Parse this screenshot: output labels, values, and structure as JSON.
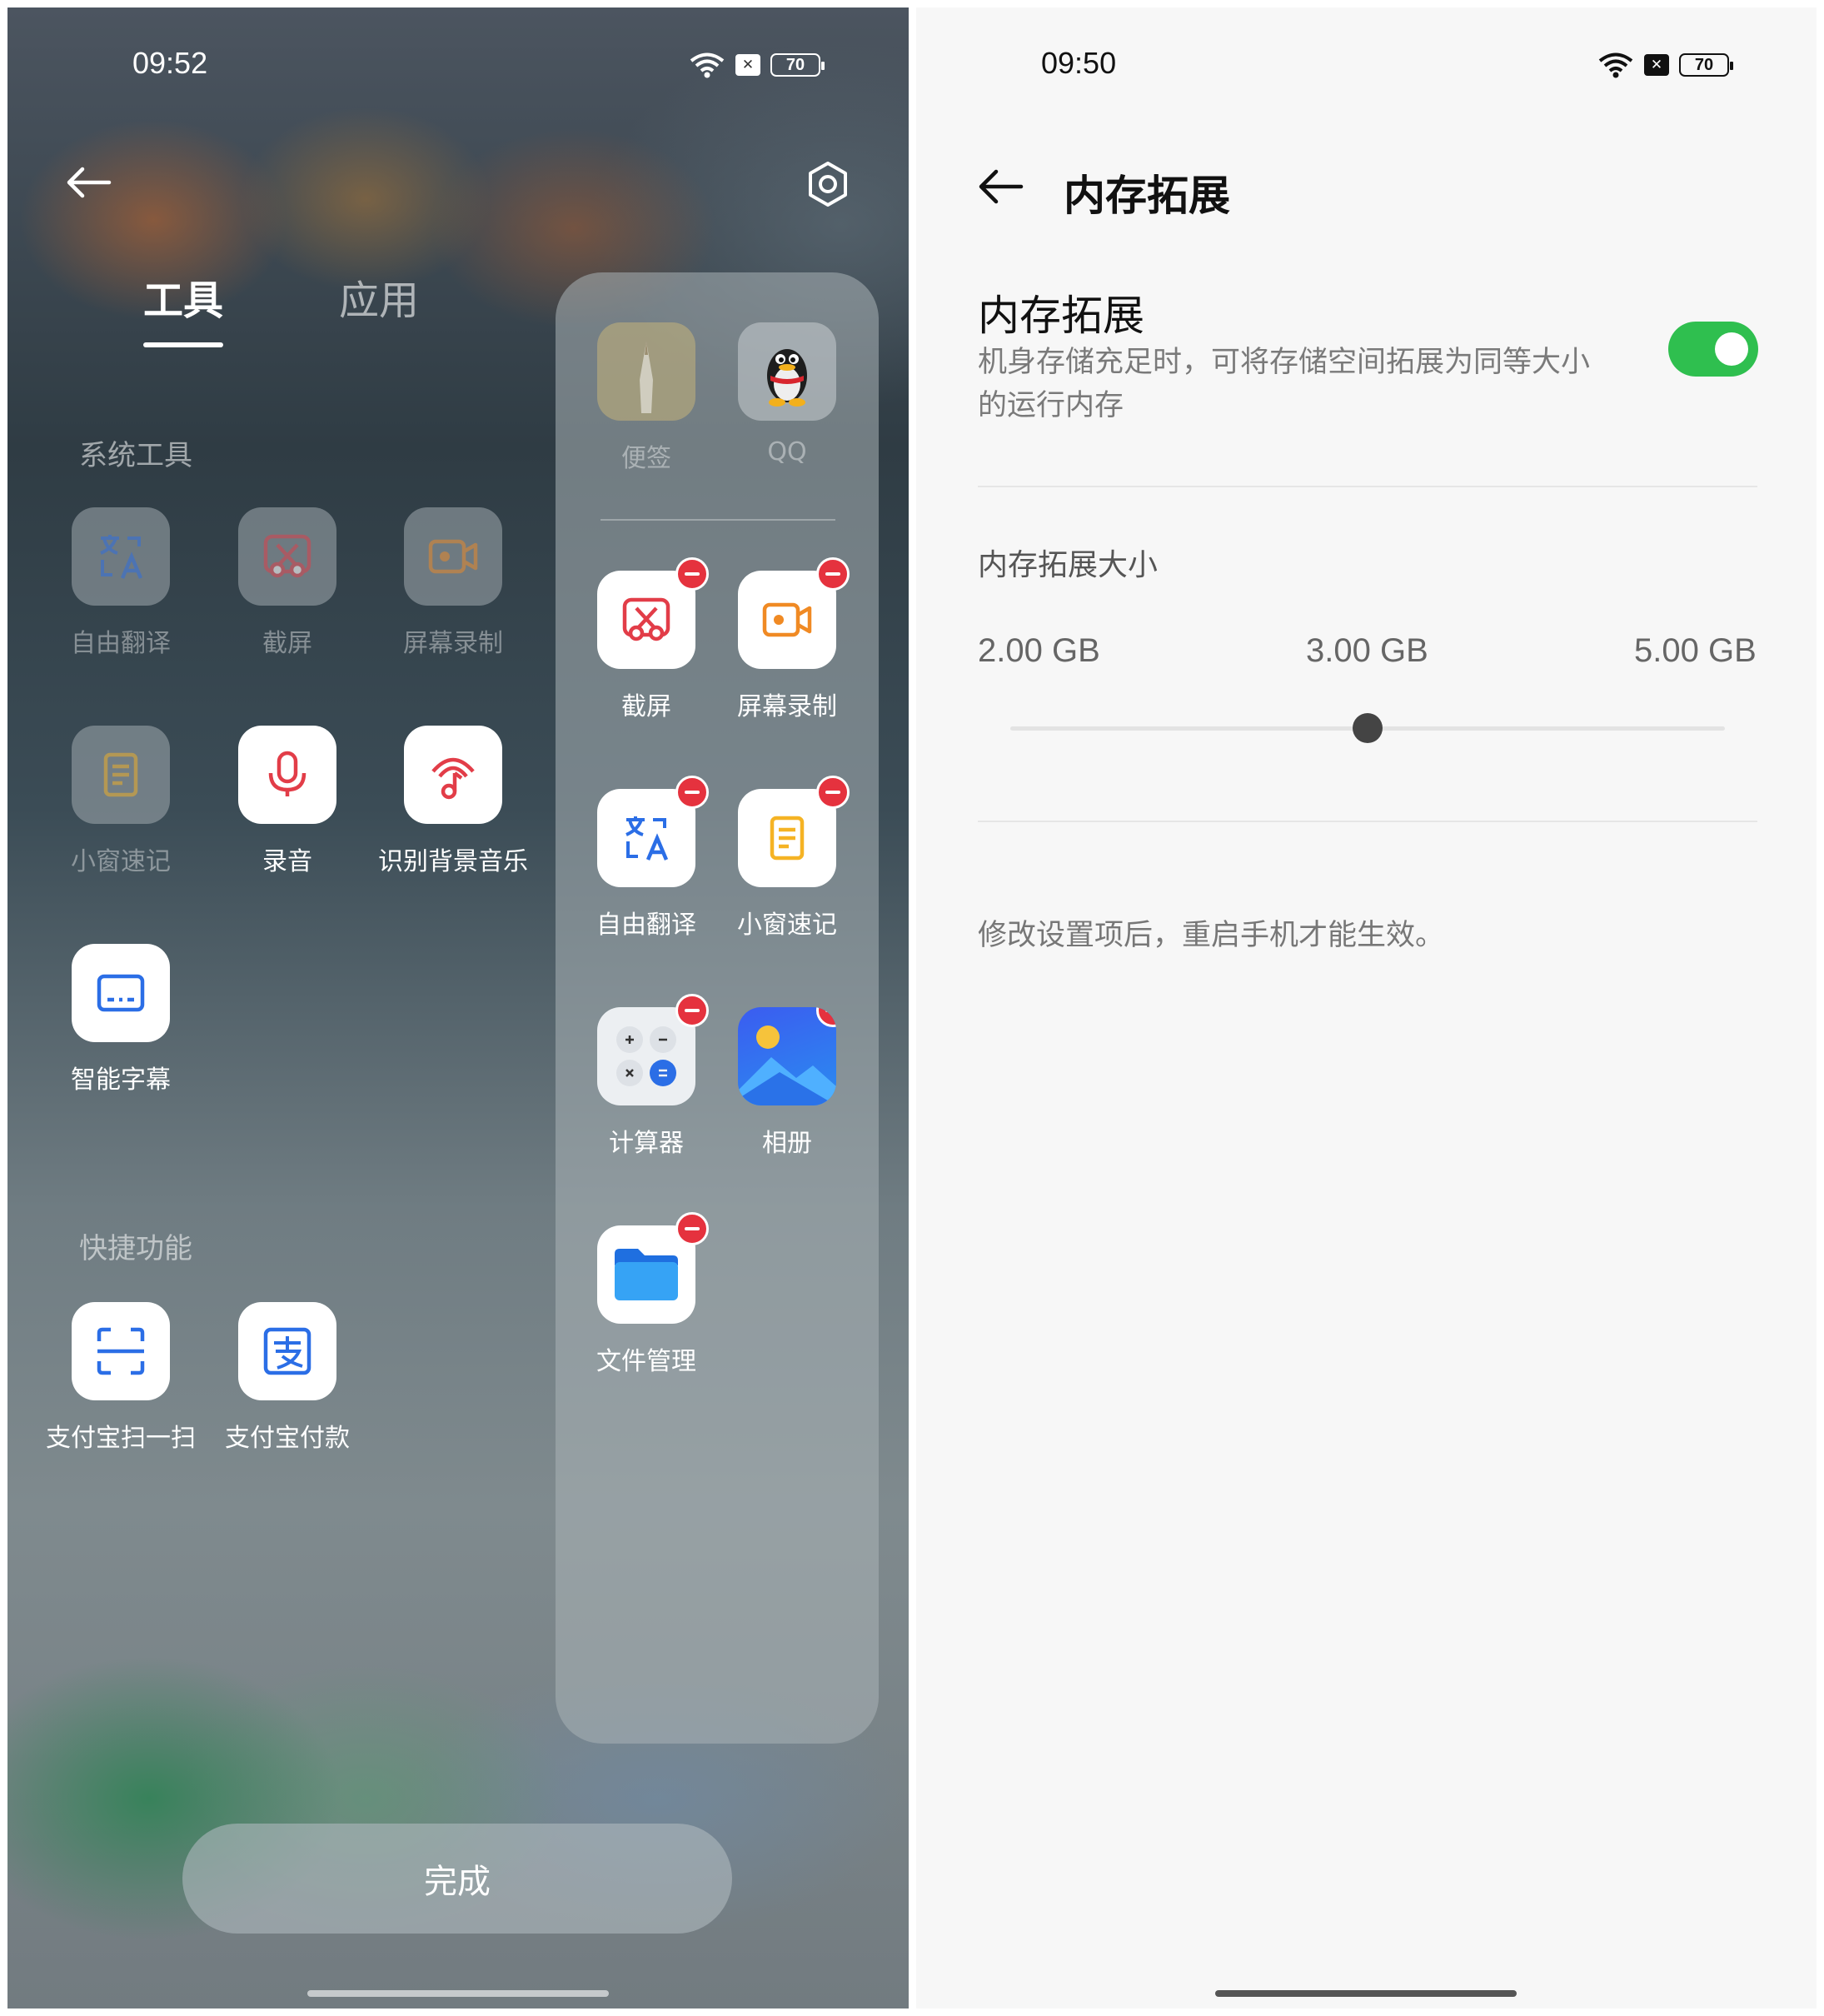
{
  "left": {
    "status": {
      "time": "09:52",
      "battery": "70"
    },
    "tabs": [
      "工具",
      "应用"
    ],
    "system_tools": {
      "title": "系统工具",
      "items": [
        {
          "label": "自由翻译",
          "icon": "translate-icon",
          "state": "added"
        },
        {
          "label": "截屏",
          "icon": "screenshot-icon",
          "state": "added"
        },
        {
          "label": "屏幕录制",
          "icon": "screen-record-icon",
          "state": "added"
        },
        {
          "label": "小窗速记",
          "icon": "note-icon",
          "state": "added"
        },
        {
          "label": "录音",
          "icon": "microphone-icon",
          "state": "available"
        },
        {
          "label": "识别背景音乐",
          "icon": "music-recognition-icon",
          "state": "available"
        },
        {
          "label": "智能字幕",
          "icon": "subtitle-icon",
          "state": "available"
        }
      ]
    },
    "quick_functions": {
      "title": "快捷功能",
      "items": [
        {
          "label": "支付宝扫一扫",
          "icon": "scan-icon"
        },
        {
          "label": "支付宝付款",
          "icon": "alipay-pay-icon"
        }
      ]
    },
    "sidebar": {
      "fixed": [
        {
          "label": "便签",
          "icon": "notes-app-icon"
        },
        {
          "label": "QQ",
          "icon": "qq-penguin-icon"
        }
      ],
      "items": [
        {
          "label": "截屏",
          "icon": "screenshot-icon"
        },
        {
          "label": "屏幕录制",
          "icon": "screen-record-icon"
        },
        {
          "label": "自由翻译",
          "icon": "translate-icon"
        },
        {
          "label": "小窗速记",
          "icon": "note-icon"
        },
        {
          "label": "计算器",
          "icon": "calculator-icon"
        },
        {
          "label": "相册",
          "icon": "gallery-icon"
        },
        {
          "label": "文件管理",
          "icon": "folder-icon"
        }
      ]
    },
    "done_label": "完成"
  },
  "right": {
    "status": {
      "time": "09:50",
      "battery": "70"
    },
    "title": "内存拓展",
    "setting": {
      "title": "内存拓展",
      "description": "机身存储充足时，可将存储空间拓展为同等大小的运行内存",
      "enabled": true
    },
    "size_section": {
      "title": "内存拓展大小",
      "options": [
        "2.00 GB",
        "3.00 GB",
        "5.00 GB"
      ],
      "selected": "3.00 GB"
    },
    "note": "修改设置项后，重启手机才能生效。"
  },
  "colors": {
    "toggle_on": "#2fbf4f",
    "remove_badge": "#e5323e",
    "accent_blue": "#2b6ee6"
  }
}
